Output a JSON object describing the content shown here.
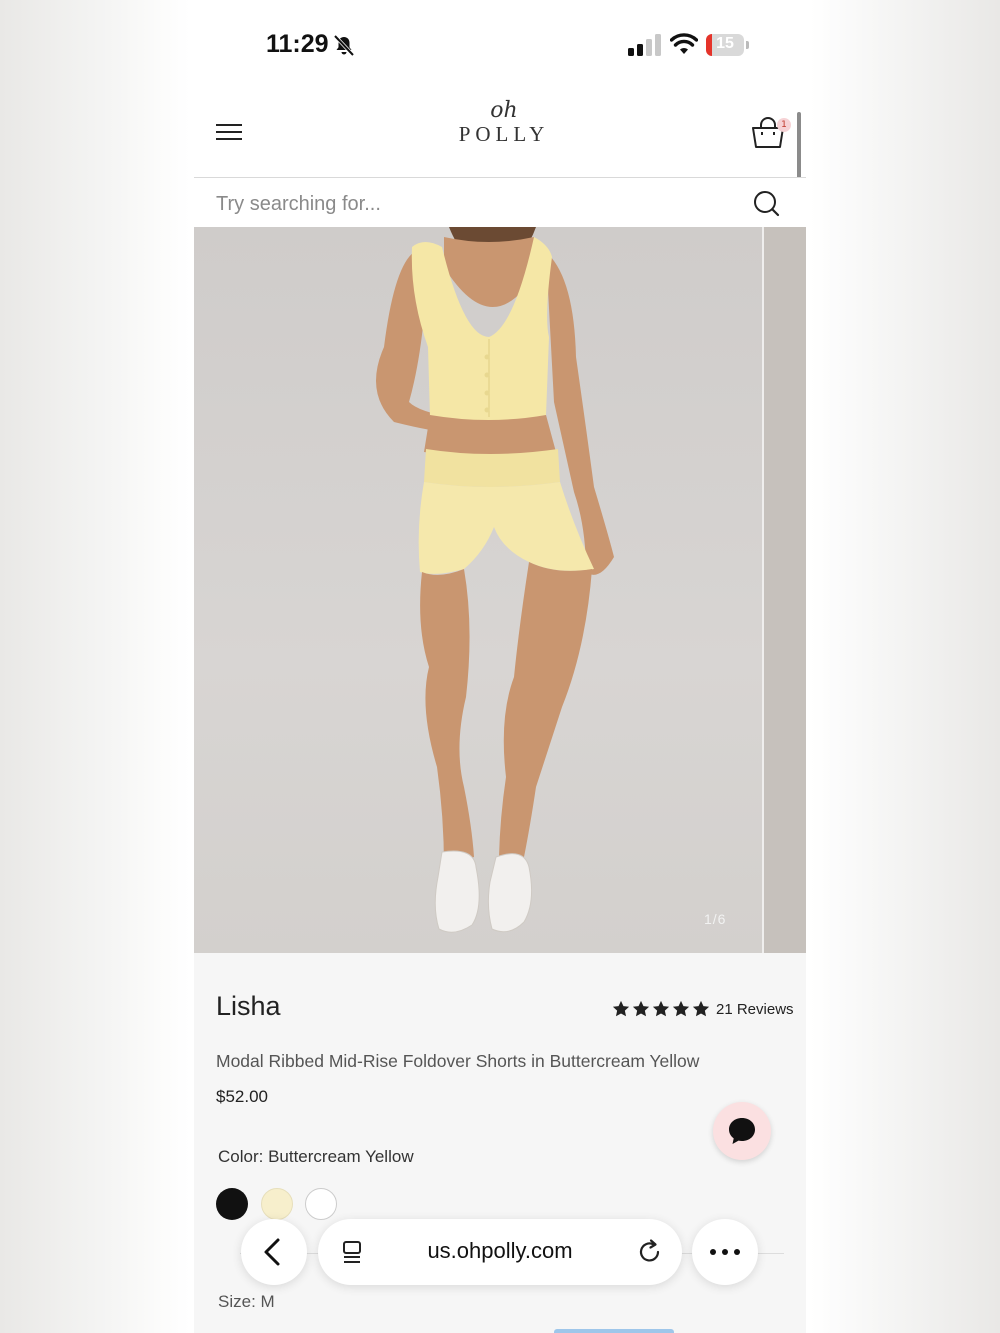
{
  "status_bar": {
    "time": "11:29",
    "battery": "15",
    "icons": [
      "bell-slash-icon",
      "signal-icon",
      "wifi-icon",
      "battery-icon"
    ]
  },
  "header": {
    "logo_script": "oh",
    "logo_word": "POLLY",
    "cart_count": "1",
    "icons": [
      "menu-icon",
      "cart-icon"
    ]
  },
  "search": {
    "placeholder": "Try searching for...",
    "icon": "search-icon"
  },
  "gallery": {
    "counter": "1/6"
  },
  "product": {
    "name": "Lisha",
    "rating_stars": 5,
    "reviews": "21 Reviews",
    "subtitle": "Modal Ribbed Mid-Rise Foldover Shorts in Buttercream Yellow",
    "price": "$52.00",
    "color_label": "Color: Buttercream Yellow",
    "swatches": [
      {
        "name": "black",
        "color": "#111111"
      },
      {
        "name": "buttercream-yellow",
        "color": "#f7efcc"
      },
      {
        "name": "white",
        "color": "#ffffff"
      }
    ],
    "size_label": "Size: M"
  },
  "chat": {
    "icon": "chat-bubble-icon",
    "color": "#fbe0e1"
  },
  "browser": {
    "url": "us.ohpolly.com",
    "icons": [
      "back-arrow-icon",
      "tabs-icon",
      "reload-icon",
      "more-icon"
    ]
  }
}
